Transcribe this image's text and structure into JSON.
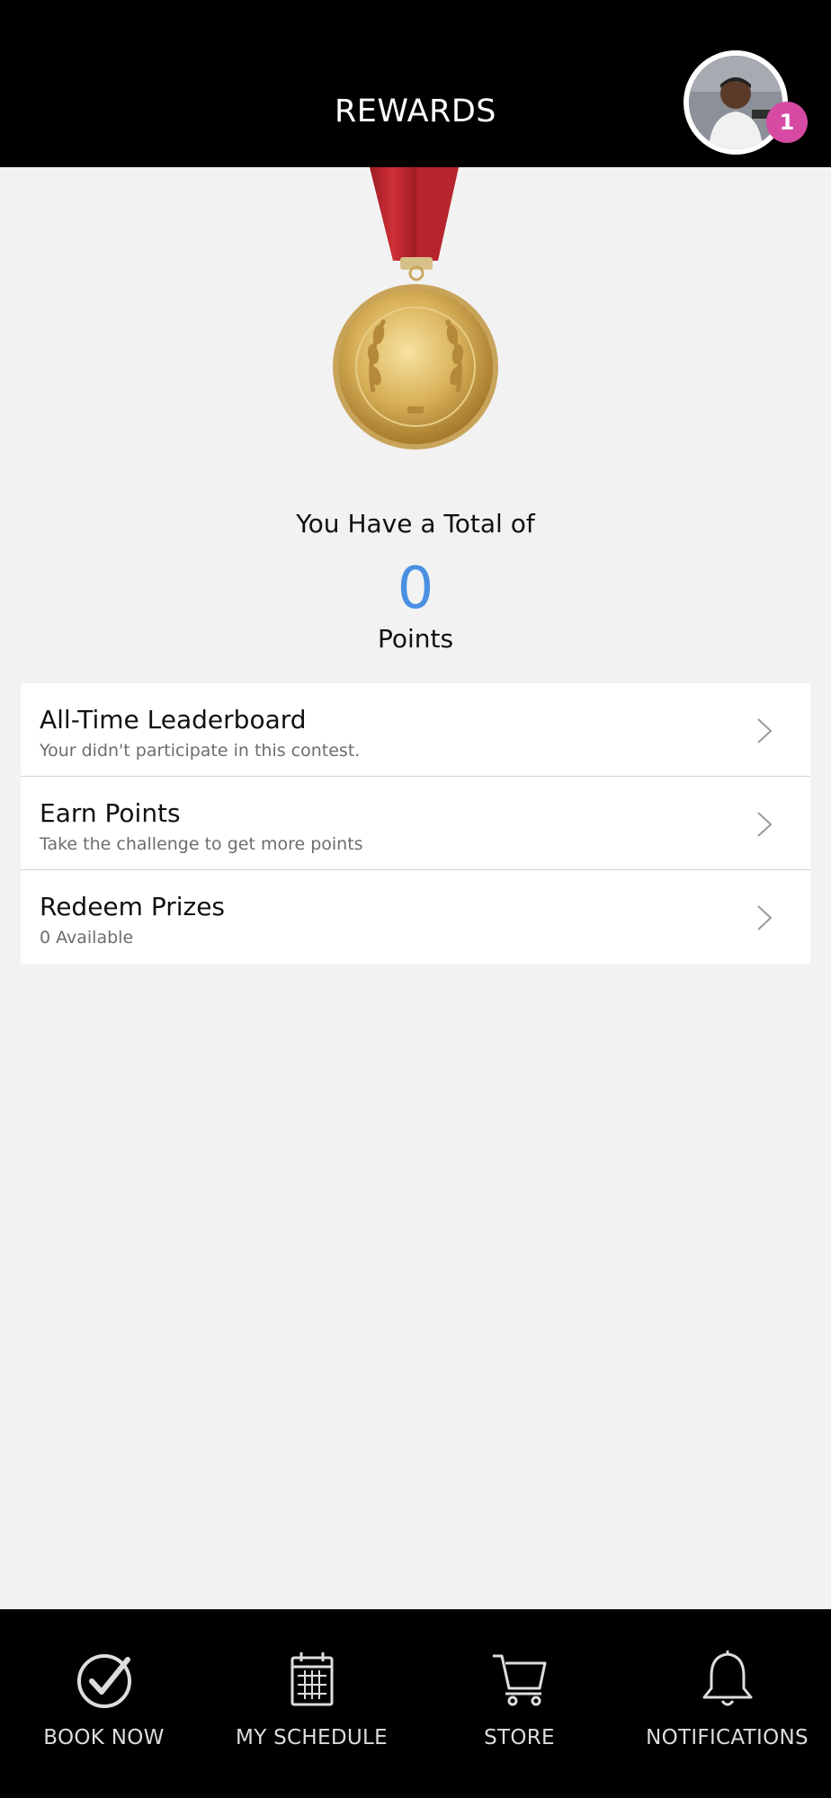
{
  "header": {
    "title": "REWARDS",
    "notification_count": "1"
  },
  "summary": {
    "total_label": "You Have a Total of",
    "points_value": "0",
    "points_label": "Points"
  },
  "list": {
    "items": [
      {
        "title": "All-Time Leaderboard",
        "subtitle": "Your didn't participate in this contest."
      },
      {
        "title": "Earn Points",
        "subtitle": "Take the challenge to get more points"
      },
      {
        "title": "Redeem Prizes",
        "subtitle": "0 Available"
      }
    ]
  },
  "nav": {
    "items": [
      {
        "label": "BOOK NOW",
        "icon": "check-circle-icon"
      },
      {
        "label": "MY SCHEDULE",
        "icon": "calendar-icon"
      },
      {
        "label": "STORE",
        "icon": "cart-icon"
      },
      {
        "label": "NOTIFICATIONS",
        "icon": "bell-icon"
      }
    ]
  },
  "colors": {
    "header_bg": "#000000",
    "page_bg": "#f2f2f2",
    "points_accent": "#4a90e2",
    "badge": "#d64aa3",
    "medal_gold": "#d9b25a",
    "ribbon_red": "#c0262d"
  }
}
